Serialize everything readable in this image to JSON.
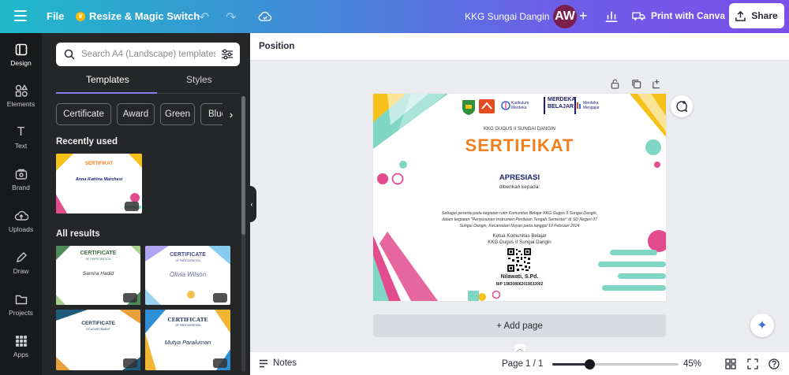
{
  "topbar": {
    "file_label": "File",
    "resize_label": "Resize & Magic Switch",
    "doc_title": "KKG Sungai Dangin",
    "avatar_initials": "AW",
    "print_label": "Print with Canva",
    "share_label": "Share",
    "gradient_start": "#1fb9c9",
    "gradient_end": "#7b4fe8"
  },
  "rail": {
    "items": [
      {
        "label": "Design",
        "icon": "design-icon"
      },
      {
        "label": "Elements",
        "icon": "elements-icon"
      },
      {
        "label": "Text",
        "icon": "text-icon"
      },
      {
        "label": "Brand",
        "icon": "brand-icon"
      },
      {
        "label": "Uploads",
        "icon": "uploads-icon"
      },
      {
        "label": "Draw",
        "icon": "draw-icon"
      },
      {
        "label": "Projects",
        "icon": "projects-icon"
      },
      {
        "label": "Apps",
        "icon": "apps-icon"
      }
    ]
  },
  "panel": {
    "search_placeholder": "Search A4 (Landscape) templates",
    "tabs": [
      "Templates",
      "Styles"
    ],
    "chips": [
      "Certificate",
      "Award",
      "Green",
      "Blue"
    ],
    "recently_used": "Recently used",
    "all_results": "All results",
    "recent_thumb": {
      "title": "SERTIFIKAT",
      "name": "Anna Katrina Marchesi"
    },
    "results": [
      {
        "title": "CERTIFICATE",
        "subtitle": "OF PARTICIPATION",
        "name": "Samira Hadid"
      },
      {
        "title": "CERTIFICATE",
        "subtitle": "OF PARTICIPATION",
        "name": "Olivia Wilson"
      },
      {
        "title": "CERTIFICATE",
        "subtitle": "OF ACHIEVEMENT",
        "name": ""
      },
      {
        "title": "CERTIFICATE",
        "subtitle": "OF PARTICIPATION",
        "name": "Mutya Paraluman"
      }
    ]
  },
  "context_bar": {
    "position_label": "Position"
  },
  "certificate": {
    "logo_text_1": "Kurikulum Merdeka",
    "logo_text_2": "MERDEKA BELAJAR",
    "logo_text_3": "Merdeka Mengajar",
    "org": "KKG GUGUS II SUNGAI DANGIN",
    "title": "SERTIFIKAT",
    "subtitle": "APRESIASI",
    "given_to": "diberikan kepada:",
    "body_line1": "Sebagai peserta pada kegiatan rutin Komunitas Belajar KKG Gugus II Sungai Dangin,",
    "body_line2": "dalam kegiatan \"Penyusunan Instrumen Penilaian Tengah Semester\" di SD Negeri 07",
    "body_line3": "Sungai Dangin, Kecamatan Noyan pada tanggal 19 Februari 2024",
    "signer_role1": "Ketua Komunitas Belajar",
    "signer_role2": "KKG Gugus II Sungai Dangin",
    "signer_name": "Nilawati, S.Pd.",
    "signer_nip": "NIP 198308062019032002",
    "title_color": "#f07f1f",
    "subtitle_color": "#1d1f6e"
  },
  "canvas": {
    "add_page_label": "+ Add page"
  },
  "bottombar": {
    "notes_label": "Notes",
    "page_label": "Page 1 / 1",
    "zoom_label": "45%",
    "zoom_value": 0.45
  }
}
